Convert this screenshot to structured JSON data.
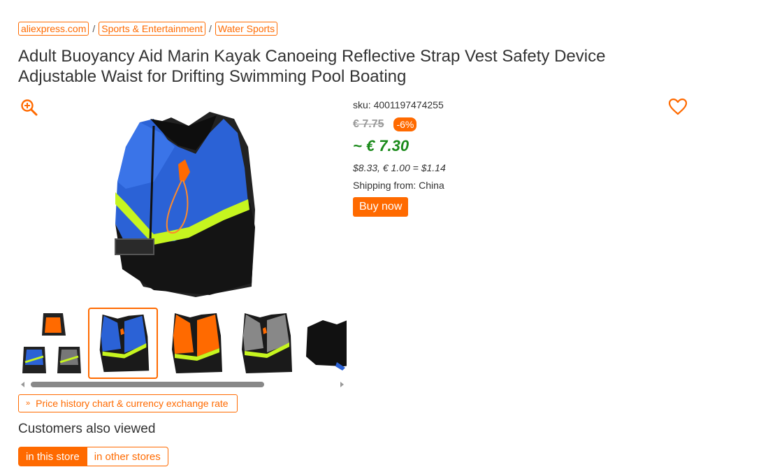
{
  "breadcrumb": {
    "items": [
      "aliexpress.com",
      "Sports & Entertainment",
      "Water Sports"
    ],
    "separator": "/"
  },
  "product": {
    "title": "Adult Buoyancy Aid Marin Kayak Canoeing Reflective Strap Vest Safety Device Adjustable Waist for Drifting Swimming Pool Boating",
    "sku": "sku: 4001197474255",
    "old_price": "€ 7.75",
    "discount": "-6%",
    "price": "~ € 7.30",
    "conversion": "$8.33, € 1.00 = $1.14",
    "shipping": "Shipping from: China",
    "buy_label": "Buy now"
  },
  "gallery": {
    "icons": {
      "zoom": "zoom-in-icon",
      "wishlist": "heart-icon"
    },
    "selected_thumbnail": 2
  },
  "price_history": {
    "label": "Price history chart & currency exchange rate",
    "icon": "double-chevron-down-icon"
  },
  "also_viewed": {
    "heading": "Customers also viewed",
    "tabs": [
      "in this store",
      "in other stores"
    ],
    "active_tab": 1
  },
  "colors": {
    "accent": "#ff6a00",
    "price_green": "#1a8a1a"
  }
}
